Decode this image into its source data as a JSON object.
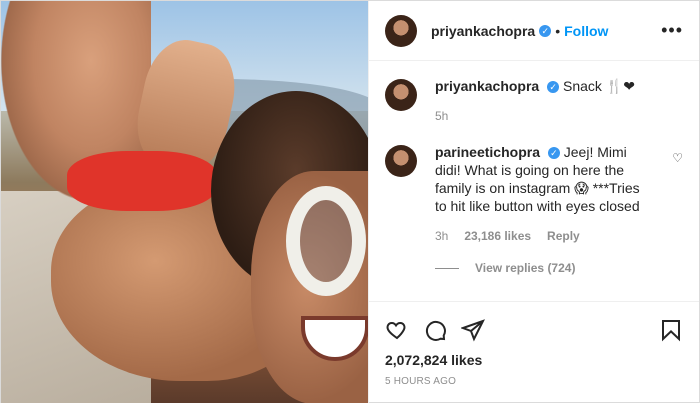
{
  "header": {
    "username": "priyankachopra",
    "verified_icon": "verified-badge-icon",
    "separator": "•",
    "follow_label": "Follow",
    "more_label": "•••"
  },
  "caption": {
    "username": "priyankachopra",
    "text": "Snack 🍴❤",
    "time": "5h"
  },
  "comment": {
    "username": "parineetichopra",
    "text": "Jeej! Mimi didi! What is going on here the family is on instagram 😱 ***Tries to hit like button with eyes closed",
    "time": "3h",
    "likes": "23,186 likes",
    "reply_label": "Reply"
  },
  "view_replies": "View replies (724)",
  "post": {
    "likes": "2,072,824 likes",
    "timestamp": "5 HOURS AGO"
  },
  "icons": [
    "heart-icon",
    "comment-icon",
    "share-icon",
    "bookmark-icon"
  ],
  "colors": {
    "accent": "#0095f6",
    "text": "#262626",
    "muted": "#8e8e8e"
  }
}
